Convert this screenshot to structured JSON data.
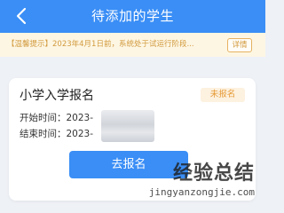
{
  "header": {
    "title": "待添加的学生",
    "back_icon": "chevron-left-icon"
  },
  "notice": {
    "text": "【温馨提示】2023年4月1日前，系统处于试运行阶段...",
    "detail_label": "详情"
  },
  "card": {
    "title": "小学入学报名",
    "status": "未报名",
    "start_label": "开始时间：",
    "start_value": "2023-",
    "end_label": "结束时间：",
    "end_value": "2023-",
    "action_label": "去报名"
  },
  "watermark": {
    "cn": "经验总结",
    "pinyin": "jingyanzongjie.com"
  },
  "colors": {
    "primary": "#3a8ef6",
    "notice_bg": "#fdf6e3",
    "notice_text": "#d29a3e",
    "status_text": "#e69a36",
    "page_bg": "#eef1f6"
  }
}
